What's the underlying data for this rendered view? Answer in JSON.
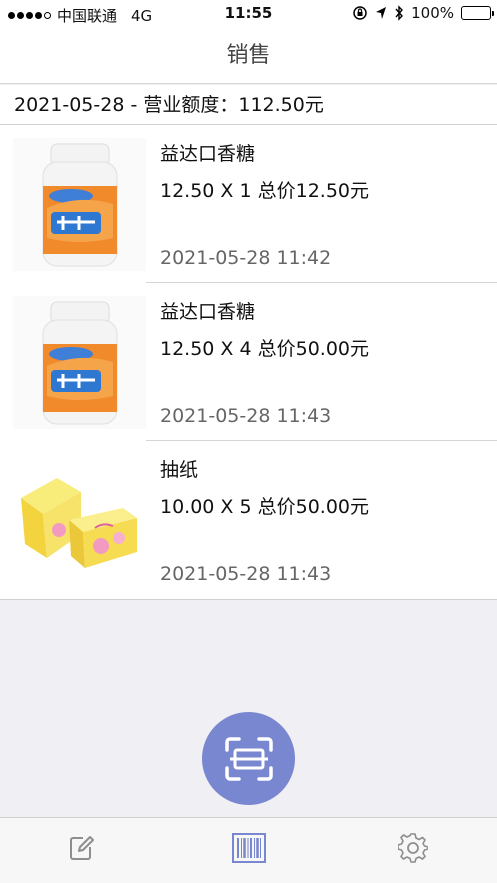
{
  "status_bar": {
    "carrier": "中国联通",
    "network": "4G",
    "time": "11:55",
    "battery": "100%",
    "battery_level": 1.0,
    "battery_color": "#4cd964"
  },
  "nav": {
    "title": "销售"
  },
  "summary": {
    "text": "2021-05-28 - 营业额度：112.50元"
  },
  "sales": [
    {
      "name": "益达口香糖",
      "price_line": "12.50 X 1  总价12.50元",
      "time": "2021-05-28 11:42",
      "image": "gum-bottle-image"
    },
    {
      "name": "益达口香糖",
      "price_line": "12.50 X 4  总价50.00元",
      "time": "2021-05-28 11:43",
      "image": "gum-bottle-image"
    },
    {
      "name": "抽纸",
      "price_line": "10.00 X 5  总价50.00元",
      "time": "2021-05-28 11:43",
      "image": "tissue-pack-image"
    }
  ],
  "scan_button": {
    "icon": "scan-icon",
    "color": "#7887cf"
  },
  "tabbar": {
    "tabs": [
      {
        "icon": "edit-icon",
        "active": false
      },
      {
        "icon": "barcode-icon",
        "active": true
      },
      {
        "icon": "gear-icon",
        "active": false
      }
    ],
    "active_color": "#7887cf",
    "inactive_color": "#8e8e8e"
  }
}
